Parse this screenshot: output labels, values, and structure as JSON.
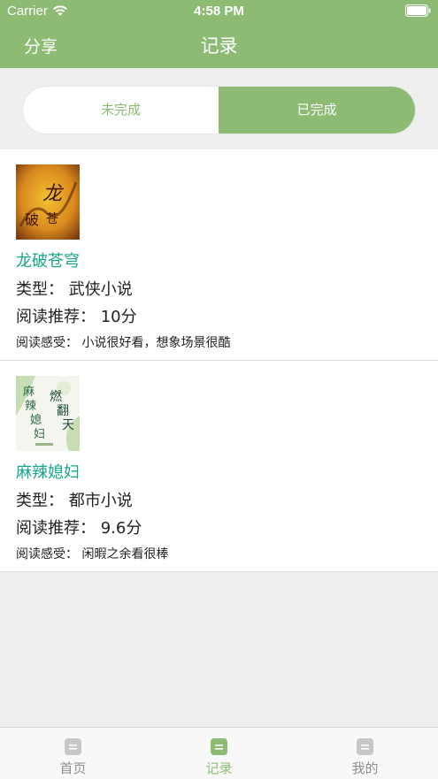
{
  "status_bar": {
    "carrier": "Carrier",
    "time": "4:58 PM"
  },
  "nav": {
    "share_label": "分享",
    "title": "记录"
  },
  "segment": {
    "left_label": "未完成",
    "right_label": "已完成",
    "selected": "已完成"
  },
  "records": [
    {
      "title": "龙破苍穹",
      "type": "类型：  武侠小说",
      "rating": "阅读推荐：  10分",
      "feeling": "阅读感受：  小说很好看，想象场景很酷",
      "cover_text": "龙破苍穹"
    },
    {
      "title": "麻辣媳妇",
      "type": "类型：  都市小说",
      "rating": "阅读推荐：  9.6分",
      "feeling": "阅读感受：  闲暇之余看很棒",
      "cover_text": "燃翻天 麻辣媳妇"
    }
  ],
  "tabbar": {
    "items": [
      {
        "label": "首页",
        "icon": "home-icon",
        "active": false
      },
      {
        "label": "记录",
        "icon": "record-icon",
        "active": true
      },
      {
        "label": "我的",
        "icon": "profile-icon",
        "active": false
      }
    ]
  },
  "colors": {
    "accent": "#8dbb74",
    "title_green": "#19a58a",
    "background": "#efefef"
  }
}
